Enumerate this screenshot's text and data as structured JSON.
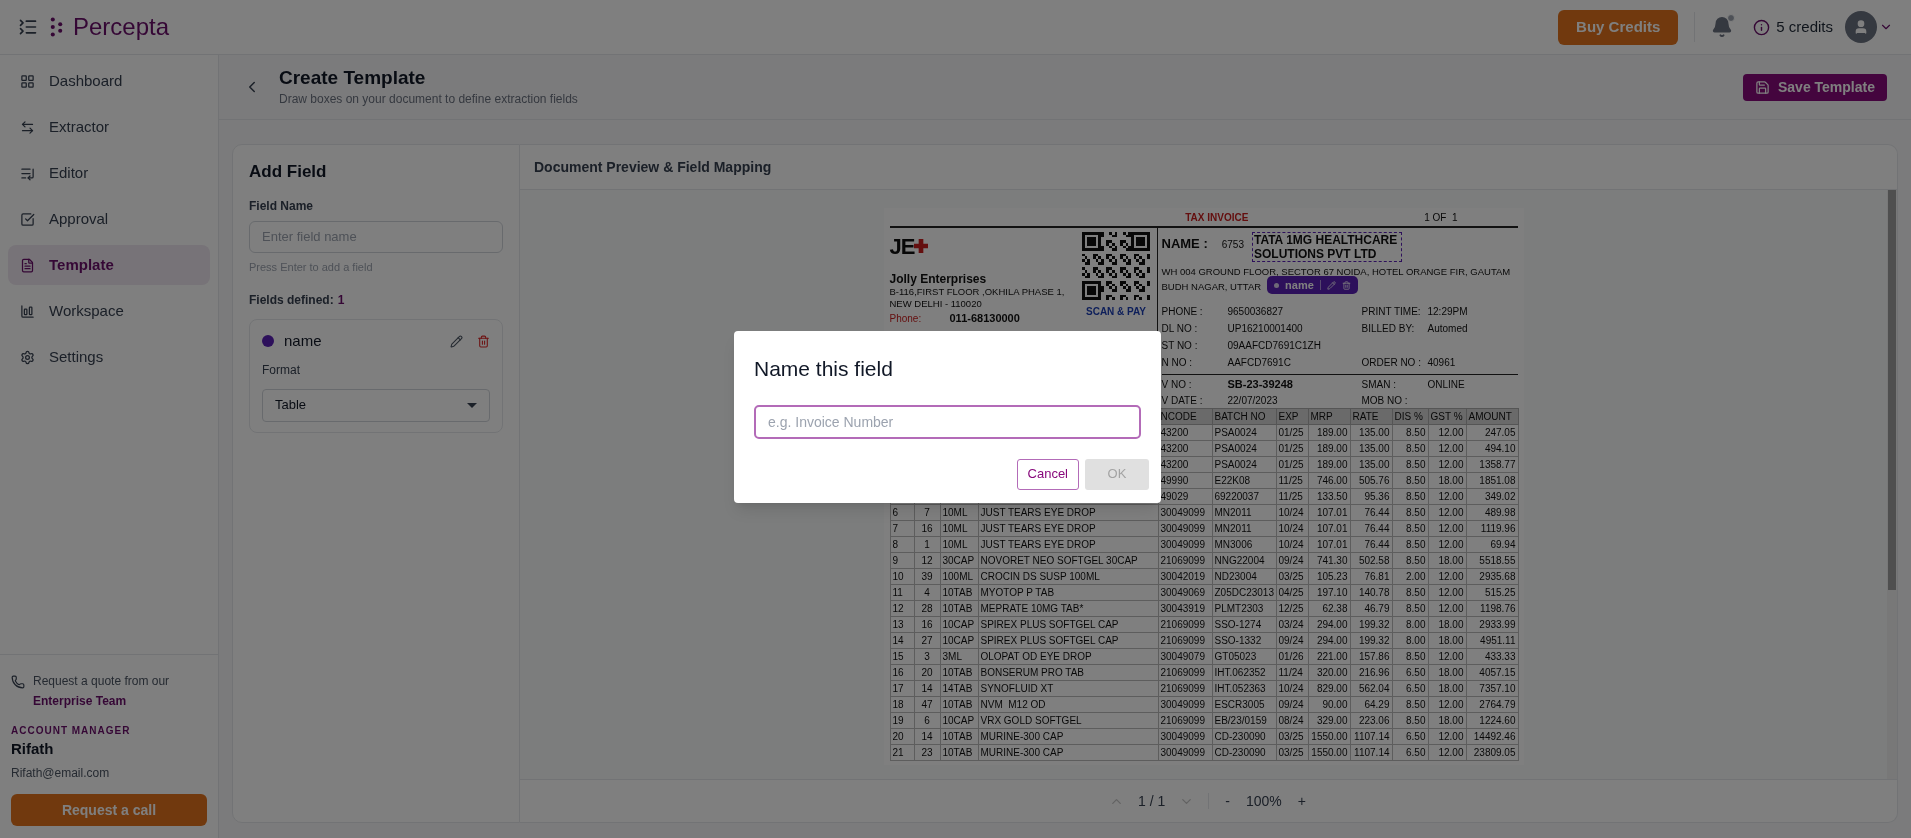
{
  "topbar": {
    "brand": "Percepta",
    "buy_button": "Buy Credits",
    "credits": "5 credits"
  },
  "sidebar": {
    "items": [
      {
        "label": "Dashboard",
        "selected": false
      },
      {
        "label": "Extractor",
        "selected": false
      },
      {
        "label": "Editor",
        "selected": false
      },
      {
        "label": "Approval",
        "selected": false
      },
      {
        "label": "Template",
        "selected": true
      },
      {
        "label": "Workspace",
        "selected": false
      },
      {
        "label": "Settings",
        "selected": false
      }
    ],
    "quote_text": "Request a quote from our",
    "quote_link": "Enterprise Team",
    "manager_label": "ACCOUNT MANAGER",
    "manager_name": "Rifath",
    "manager_email": "Rifath@email.com",
    "call_button": "Request a call"
  },
  "page_header": {
    "title": "Create Template",
    "subtitle": "Draw boxes on your document to define extraction fields",
    "save_button": "Save Template"
  },
  "add_field": {
    "title": "Add Field",
    "field_label": "Field Name",
    "placeholder": "Enter field name",
    "hint": "Press Enter to add a field",
    "defined_label": "Fields defined:",
    "defined_count": "1",
    "fields": [
      {
        "name": "name",
        "format_label": "Format",
        "format_value": "Table"
      }
    ]
  },
  "preview": {
    "title": "Document Preview & Field Mapping",
    "invoice": {
      "title": "TAX INVOICE",
      "page": "1 OF  1",
      "logo": "JE",
      "seller": {
        "name": "Jolly Enterprises",
        "address": [
          "B-116,FIRST FLOOR ,OKHILA PHASE 1,",
          "NEW DELHI - 110020"
        ],
        "phone_label": "Phone:",
        "phone": "011-68130000",
        "scan": "SCAN & PAY"
      },
      "buyer": {
        "label": "NAME :",
        "code": "6753",
        "name": "TATA 1MG HEALTHCARE SOLUTIONS PVT LTD",
        "highlighted": true,
        "address": [
          "WH 004 GROUND FLOOR, SECTOR 67 NOIDA, HOTEL ORANGE FIR, GAUTAM",
          "BUDH NAGAR, UTTAR"
        ]
      },
      "field_tag": {
        "label": "name"
      },
      "details": [
        [
          {
            "label": "PHONE :",
            "value": "9650036827"
          },
          {
            "label": "PRINT TIME:",
            "value": "12:29PM"
          }
        ],
        [
          {
            "label": "DL NO :",
            "value": "UP16210001400"
          },
          {
            "label": "BILLED BY:",
            "value": "Automed"
          }
        ],
        [
          {
            "label": "ST NO :",
            "value": "09AAFCD7691C1ZH"
          }
        ],
        [
          {
            "label": "N NO :",
            "value": "AAFCD7691C"
          },
          {
            "label": "ORDER NO :",
            "value": "40961"
          }
        ]
      ],
      "bill_details": [
        [
          {
            "label": "V NO :",
            "value": "SB-23-39248"
          },
          {
            "label": "SMAN :",
            "value": "ONLINE"
          }
        ],
        [
          {
            "label": "V DATE :",
            "value": "22/07/2023"
          },
          {
            "label": "MOB NO :"
          }
        ]
      ],
      "columns": [
        "NCODE",
        "BATCH NO",
        "EXP",
        "MRP",
        "RATE",
        "DIS %",
        "GST %",
        "AMOUNT"
      ],
      "rows": [
        [
          "43200",
          "PSA0024",
          "01/25",
          "189.00",
          "135.00",
          "8.50",
          "12.00",
          "247.05"
        ],
        [
          "43200",
          "PSA0024",
          "01/25",
          "189.00",
          "135.00",
          "8.50",
          "12.00",
          "494.10"
        ],
        [
          "43200",
          "PSA0024",
          "01/25",
          "189.00",
          "135.00",
          "8.50",
          "12.00",
          "1358.77"
        ],
        [
          "49990",
          "E22K08",
          "11/25",
          "746.00",
          "505.76",
          "8.50",
          "18.00",
          "1851.08"
        ],
        [
          "49029",
          "69220037",
          "11/25",
          "133.50",
          "95.36",
          "8.50",
          "12.00",
          "349.02"
        ],
        [
          "6",
          "7",
          "10ML",
          "JUST TEARS EYE DROP",
          "30049099",
          "MN2011",
          "10/24",
          "107.01",
          "76.44",
          "8.50",
          "12.00",
          "489.98"
        ],
        [
          "7",
          "16",
          "10ML",
          "JUST TEARS EYE DROP",
          "30049099",
          "MN2011",
          "10/24",
          "107.01",
          "76.44",
          "8.50",
          "12.00",
          "1119.96"
        ],
        [
          "8",
          "1",
          "10ML",
          "JUST TEARS EYE DROP",
          "30049099",
          "MN3006",
          "10/24",
          "107.01",
          "76.44",
          "8.50",
          "12.00",
          "69.94"
        ],
        [
          "9",
          "12",
          "30CAP",
          "NOVORET NEO SOFTGEL 30CAP",
          "21069099",
          "NNG22004",
          "09/24",
          "741.30",
          "502.58",
          "8.50",
          "18.00",
          "5518.55"
        ],
        [
          "10",
          "39",
          "100ML",
          "CROCIN DS SUSP 100ML",
          "30042019",
          "ND23004",
          "03/25",
          "105.23",
          "76.81",
          "2.00",
          "12.00",
          "2935.68"
        ],
        [
          "11",
          "4",
          "10TAB",
          "MYOTOP P TAB",
          "30049069",
          "Z05DC23013",
          "04/25",
          "197.10",
          "140.78",
          "8.50",
          "12.00",
          "515.25"
        ],
        [
          "12",
          "28",
          "10TAB",
          "MEPRATE 10MG TAB*",
          "30043919",
          "PLMT2303",
          "12/25",
          "62.38",
          "46.79",
          "8.50",
          "12.00",
          "1198.76"
        ],
        [
          "13",
          "16",
          "10CAP",
          "SPIREX PLUS SOFTGEL CAP",
          "21069099",
          "SSO-1274",
          "03/24",
          "294.00",
          "199.32",
          "8.00",
          "18.00",
          "2933.99"
        ],
        [
          "14",
          "27",
          "10CAP",
          "SPIREX PLUS SOFTGEL CAP",
          "21069099",
          "SSO-1332",
          "09/24",
          "294.00",
          "199.32",
          "8.00",
          "18.00",
          "4951.11"
        ],
        [
          "15",
          "3",
          "3ML",
          "OLOPAT OD EYE DROP",
          "30049079",
          "GT05023",
          "01/26",
          "221.00",
          "157.86",
          "8.50",
          "12.00",
          "433.33"
        ],
        [
          "16",
          "20",
          "10TAB",
          "BONSERUM PRO TAB",
          "21069099",
          "IHT.062352",
          "11/24",
          "320.00",
          "216.96",
          "6.50",
          "18.00",
          "4057.15"
        ],
        [
          "17",
          "14",
          "14TAB",
          "SYNOFLUID XT",
          "21069099",
          "IHT.052363",
          "10/24",
          "829.00",
          "562.04",
          "6.50",
          "18.00",
          "7357.10"
        ],
        [
          "18",
          "47",
          "10TAB",
          "NVM  M12 OD",
          "30049099",
          "ESCR3005",
          "09/24",
          "90.00",
          "64.29",
          "8.50",
          "12.00",
          "2764.79"
        ],
        [
          "19",
          "6",
          "10CAP",
          "VRX GOLD SOFTGEL",
          "21069099",
          "EB/23/0159",
          "08/24",
          "329.00",
          "223.06",
          "8.50",
          "18.00",
          "1224.60"
        ],
        [
          "20",
          "14",
          "10TAB",
          "MURINE-300 CAP",
          "30049099",
          "CD-230090",
          "03/25",
          "1550.00",
          "1107.14",
          "6.50",
          "12.00",
          "14492.46"
        ],
        [
          "21",
          "23",
          "10TAB",
          "MURINE-300 CAP",
          "30049099",
          "CD-230090",
          "03/25",
          "1550.00",
          "1107.14",
          "6.50",
          "12.00",
          "23809.05"
        ]
      ]
    },
    "pagination": {
      "page": "1 / 1",
      "zoom_out": "-",
      "zoom": "100%",
      "zoom_in": "+"
    }
  },
  "modal": {
    "title": "Name this field",
    "placeholder": "e.g. Invoice Number",
    "cancel": "Cancel",
    "ok": "OK",
    "ok_disabled": true
  }
}
